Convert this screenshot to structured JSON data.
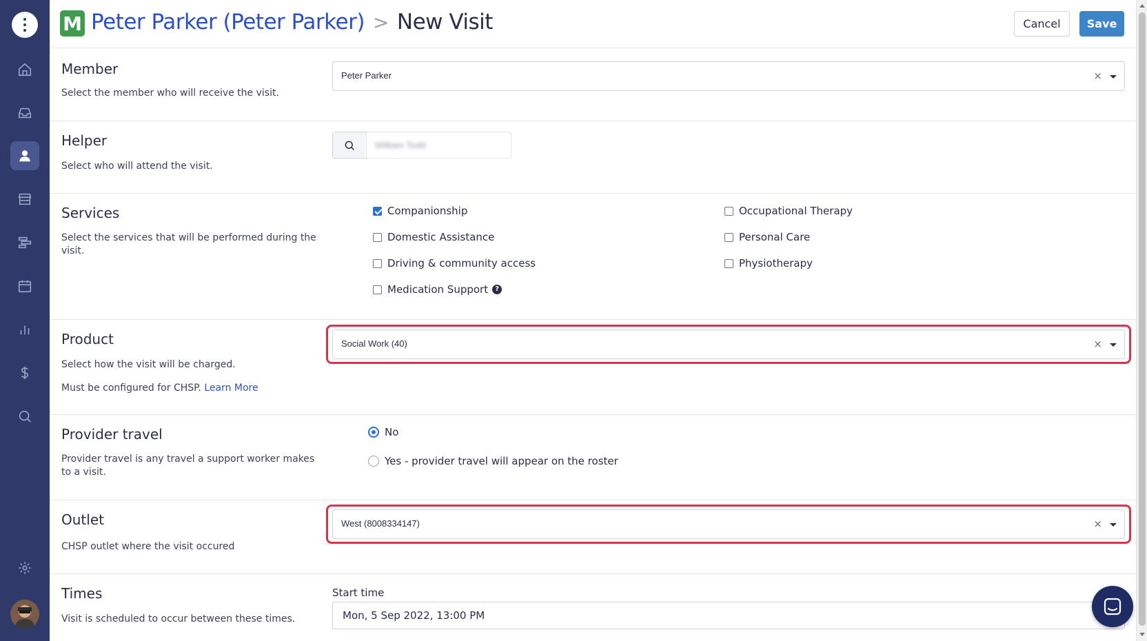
{
  "header": {
    "brand_letter": "M",
    "member_link": "Peter Parker (Peter Parker)",
    "separator": ">",
    "page_title": "New Visit",
    "cancel_label": "Cancel",
    "save_label": "Save"
  },
  "sidebar": {
    "items": [
      {
        "icon": "home-icon"
      },
      {
        "icon": "inbox-icon"
      },
      {
        "icon": "user-icon",
        "active": true
      },
      {
        "icon": "store-icon"
      },
      {
        "icon": "roster-icon"
      },
      {
        "icon": "calendar-icon"
      },
      {
        "icon": "chart-icon"
      },
      {
        "icon": "dollar-icon"
      },
      {
        "icon": "search-icon"
      },
      {
        "icon": "gear-icon"
      }
    ]
  },
  "member": {
    "title": "Member",
    "description": "Select the member who will receive the visit.",
    "value": "Peter Parker"
  },
  "helper": {
    "title": "Helper",
    "description": "Select who will attend the visit.",
    "value": "William Todd"
  },
  "services": {
    "title": "Services",
    "description": "Select the services that will be performed during the visit.",
    "options": [
      {
        "label": "Companionship",
        "checked": true
      },
      {
        "label": "Domestic Assistance",
        "checked": false
      },
      {
        "label": "Driving & community access",
        "checked": false
      },
      {
        "label": "Medication Support",
        "checked": false
      },
      {
        "label": "Occupational Therapy",
        "checked": false
      },
      {
        "label": "Personal Care",
        "checked": false
      },
      {
        "label": "Physiotherapy",
        "checked": false
      }
    ]
  },
  "product": {
    "title": "Product",
    "description": "Select how the visit will be charged.",
    "note": "Must be configured for CHSP.",
    "link": "Learn More",
    "value": "Social Work (40)"
  },
  "provider_travel": {
    "title": "Provider travel",
    "description": "Provider travel is any travel a support worker makes to a visit.",
    "options": [
      {
        "label": "No",
        "selected": true
      },
      {
        "label": "Yes - provider travel will appear on the roster",
        "selected": false
      }
    ]
  },
  "outlet": {
    "title": "Outlet",
    "description": "CHSP outlet where the visit occured",
    "value": "West (8008334147)"
  },
  "times": {
    "title": "Times",
    "description": "Visit is scheduled to occur between these times.",
    "start_label": "Start time",
    "start_value": "Mon, 5 Sep 2022, 13:00 PM"
  },
  "colors": {
    "sidebar": "#2f3a6b",
    "brand": "#3f9b4e",
    "link": "#2c4fc4",
    "save": "#3d85c9",
    "highlight": "#d9324a"
  }
}
